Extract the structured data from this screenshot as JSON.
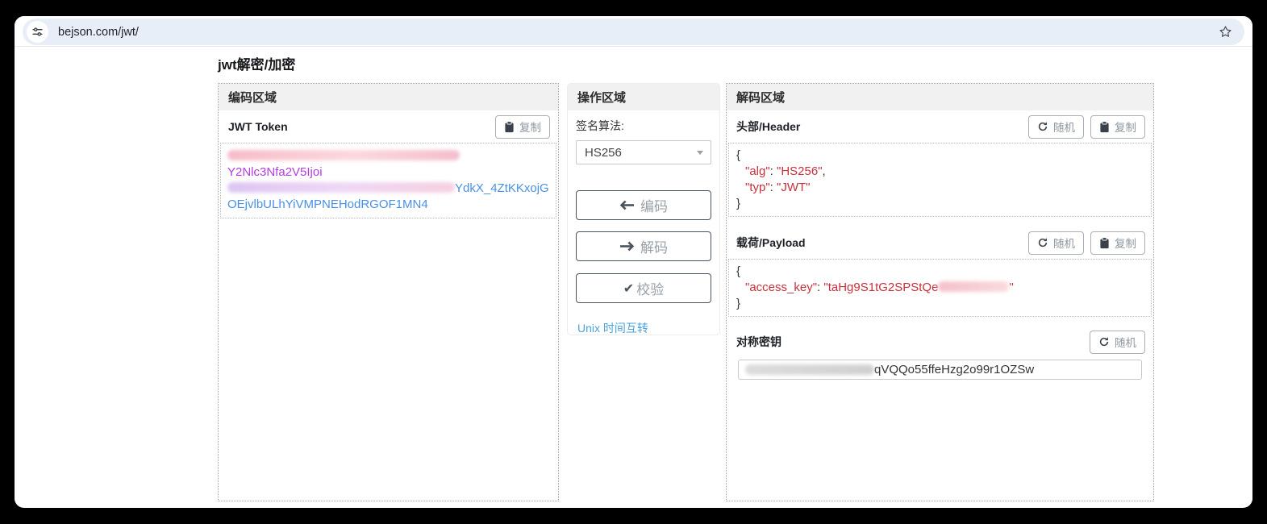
{
  "browser": {
    "url": "bejson.com/jwt/"
  },
  "page": {
    "title": "jwt解密/加密"
  },
  "encode_panel": {
    "header": "编码区域",
    "token_label": "JWT Token",
    "copy_button": "复制",
    "token": {
      "line1_visible": "Y2Nlc3Nfa2V5Ijoi",
      "line2_visible": "YdkX_4ZtKKxojG",
      "line3_visible": "OEjvlbULhYiVMPNEHodRGOF1MN4"
    }
  },
  "action_panel": {
    "header": "操作区域",
    "algorithm_label": "签名算法:",
    "algorithm_selected": "HS256",
    "encode_button": "编码",
    "decode_button": "解码",
    "verify_button": "校验",
    "verify_check": "✔",
    "unix_link": "Unix 时间互转"
  },
  "decode_panel": {
    "header": "解码区域",
    "random_button": "随机",
    "copy_button": "复制",
    "header_section": {
      "label": "头部/Header",
      "json": {
        "open": "{",
        "alg_key": "\"alg\"",
        "colon": ": ",
        "alg_value": "\"HS256\"",
        "comma": ",",
        "typ_key": "\"typ\"",
        "typ_value": "\"JWT\"",
        "close": "}"
      }
    },
    "payload_section": {
      "label": "载荷/Payload",
      "json": {
        "open": "{",
        "key": "\"access_key\"",
        "colon": ": ",
        "value_visible": "\"taHg9S1tG2SPStQe",
        "value_close_quote": "\"",
        "close": "}"
      }
    },
    "key_section": {
      "label": "对称密钥",
      "key_visible": "qVQQo55ffeHzg2o99r1OZSw"
    }
  },
  "colors": {
    "token-purple": "#b43ce0",
    "token-blue": "#4a90e2",
    "json-red": "#c7313c",
    "link-blue": "#4aa3dc",
    "panel-header-bg": "#f1f1f1",
    "omnibox-bg": "#e8eef7"
  }
}
